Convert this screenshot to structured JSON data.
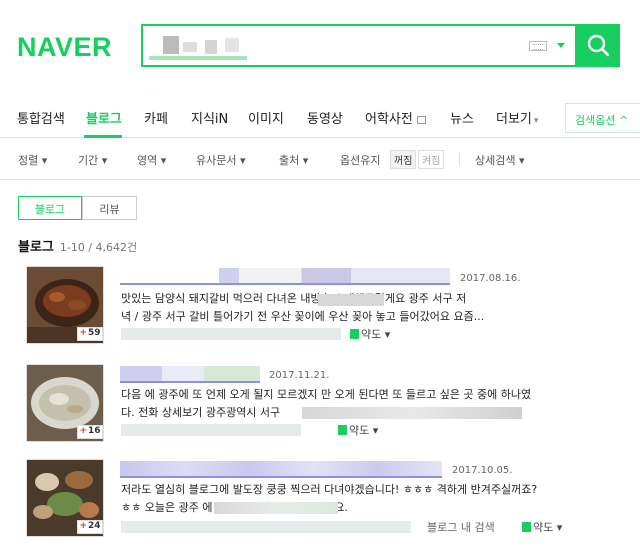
{
  "header": {
    "logo": "NAVER",
    "search_value": "",
    "search_placeholder": "",
    "accent": "#19ce60"
  },
  "tabs": [
    {
      "label": "통합검색"
    },
    {
      "label": "블로그"
    },
    {
      "label": "카페"
    },
    {
      "label": "지식iN"
    },
    {
      "label": "이미지"
    },
    {
      "label": "동영상"
    },
    {
      "label": "어학사전"
    },
    {
      "label": "뉴스"
    },
    {
      "label": "더보기"
    }
  ],
  "tab_more_arrow": "▾",
  "search_options_label": "검색옵션 ^",
  "filters": {
    "sort": "정렬 ▾",
    "period": "기간 ▾",
    "area": "영역 ▾",
    "similar": "유사문서 ▾",
    "source": "출처 ▾",
    "option_keep": "옵션유지",
    "toggle_off": "꺼짐",
    "toggle_on": "켜짐",
    "detail": "상세검색 ▾"
  },
  "subtabs": {
    "blog": "블로그",
    "review": "리뷰"
  },
  "results_header": {
    "title": "블로그",
    "count": "1-10 / 4,642건"
  },
  "items": [
    {
      "date": "2017.08.16.",
      "count": "59",
      "line1": "맛있는 담양식 돼지갈비 먹으러 다녀온              내방촌 소개해드릴게요 광주 서구 저",
      "line2": "녁 / 광주 서구 갈비 틀어가기 전 우산 꽂이에 우산 꽂아 놓고 들어갔어요 요즘...",
      "map": "약도 ▾"
    },
    {
      "date": "2017.11.21.",
      "count": "16",
      "line1": "다음 에 광주에 또 언제 오게 될지 모르겠지 만 오게 된다면 또 들르고 싶은 곳 중에 하나였",
      "line2": "다. 전화 상세보기 광주광역시 서구",
      "map": "약도 ▾"
    },
    {
      "date": "2017.10.05.",
      "count": "24",
      "line1": "저라도 열심히 블로그에 발도장 쿵쿵 찍으러 다녀야겠습니다! ㅎㅎㅎ 격하게 반겨주실꺼죠?",
      "line2": "ㅎㅎ 오늘은 광주                            에 다녀온 이야기를 해볼까해요.",
      "blog_search": "블로그 내 검색",
      "map": "약도 ▾"
    }
  ]
}
